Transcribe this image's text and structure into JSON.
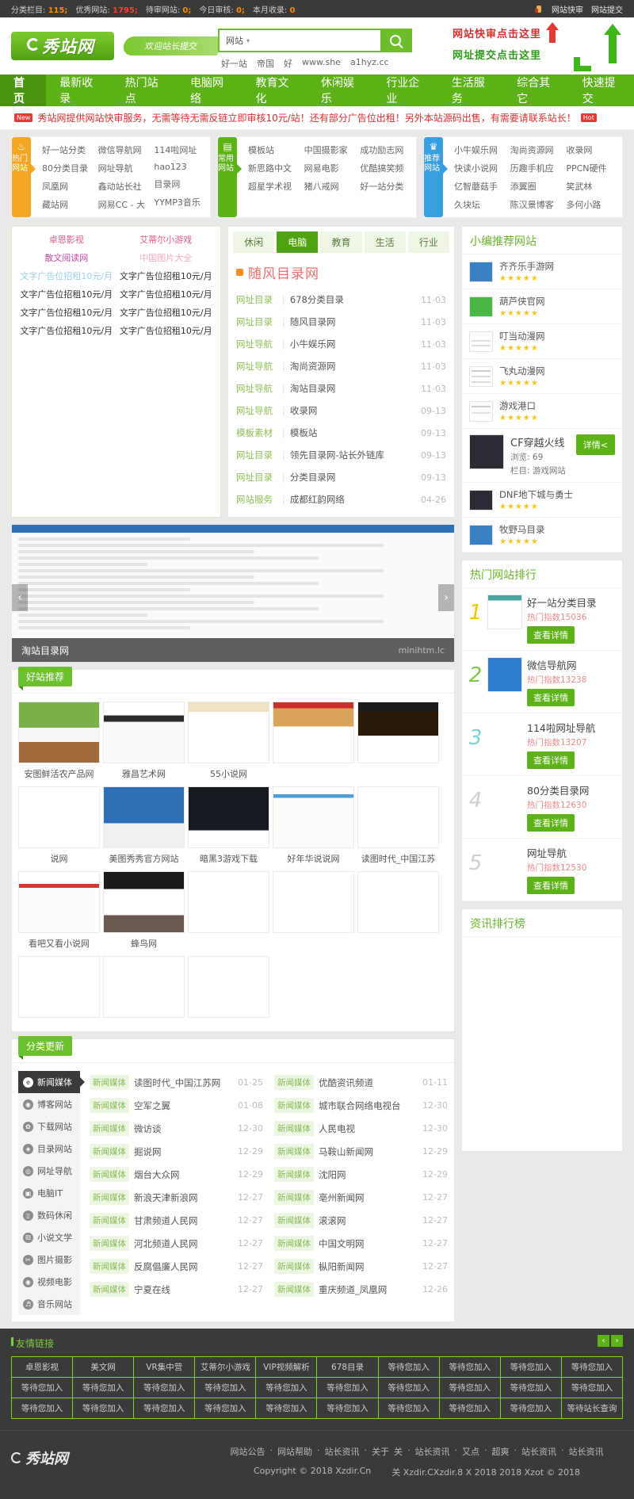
{
  "topbar": {
    "stats": [
      {
        "label": "分类栏目:",
        "value": "115;"
      },
      {
        "label": "优秀网站:",
        "value": "1795;"
      },
      {
        "label": "待审网站:",
        "value": "0;"
      },
      {
        "label": "今日审核:",
        "value": "0;"
      },
      {
        "label": "本月收录:",
        "value": "0"
      }
    ],
    "links": [
      "网站快审",
      "网站提交"
    ]
  },
  "header": {
    "logo_text": "秀站网",
    "slogan": "欢迎站长提交",
    "search": {
      "category": "网站",
      "placeholder": ""
    },
    "hotwords": [
      "好一站",
      "帝国",
      "好",
      "www.she",
      "a1hyz.cc"
    ],
    "promo_line1": "网站快审点击这里",
    "promo_line2": "网址提交点击这里"
  },
  "nav": {
    "items": [
      "首页",
      "最新收录",
      "热门站点",
      "电脑网络",
      "教育文化",
      "休闲娱乐",
      "行业企业",
      "生活服务",
      "综合其它",
      "快速提交"
    ],
    "active": "首页"
  },
  "notice": {
    "new": "New",
    "hot": "Hot",
    "text": "秀站网提供网站快审服务，无需等待无需反链立即审核10元/站！还有部分广告位出租！另外本站源码出售，有需要请联系站长！"
  },
  "quicklinks": [
    {
      "tab": "热门网站",
      "icon": "fire-icon",
      "color": "orange",
      "cols": [
        [
          "好一站分类",
          "80分类目录",
          "凤凰网",
          "藏站网"
        ],
        [
          "微信导航网",
          "网址导航",
          "鑫动站长社",
          "网易CC - 大"
        ],
        [
          "114啦网址",
          "hao123",
          "目录网",
          "YYMP3音乐"
        ]
      ]
    },
    {
      "tab": "常用网站",
      "icon": "grid-icon",
      "color": "green",
      "cols": [
        [
          "模板站",
          "新思路中文",
          "超星学术视"
        ],
        [
          "中国摄影家",
          "网易电影",
          "猪八戒网"
        ],
        [
          "成功励志网",
          "优酷搞笑频",
          "好一站分类"
        ]
      ]
    },
    {
      "tab": "推荐网站",
      "icon": "crown-icon",
      "color": "blue",
      "cols": [
        [
          "小牛娱乐网",
          "快读小说网",
          "亿智蘑菇手",
          "久块坛"
        ],
        [
          "淘尚资源网",
          "历趣手机应",
          "添翼圈",
          "陈汉景博客"
        ],
        [
          "收录网",
          "PPCN硬件",
          "笑武林",
          "多何小路"
        ]
      ]
    }
  ],
  "adbox": {
    "left": [
      "卓恩影视",
      "散文阅读网",
      "文字广告位招租10元/月",
      "文字广告位招租10元/月",
      "文字广告位招租10元/月",
      "文字广告位招租10元/月"
    ],
    "right": [
      "艾蒂尔小游戏",
      "中国图片大全",
      "文字广告位招租10元/月",
      "文字广告位招租10元/月",
      "文字广告位招租10元/月",
      "文字广告位招租10元/月"
    ]
  },
  "listbox": {
    "tabs": [
      "休闲",
      "电脑",
      "教育",
      "生活",
      "行业"
    ],
    "active_tab": "电脑",
    "brand": "随风目录网",
    "items": [
      {
        "cat": "网址目录",
        "name": "678分类目录",
        "date": "11-03"
      },
      {
        "cat": "网址目录",
        "name": "随风目录网",
        "date": "11-03"
      },
      {
        "cat": "网址导航",
        "name": "小牛娱乐网",
        "date": "11-03"
      },
      {
        "cat": "网址导航",
        "name": "淘尚资源网",
        "date": "11-03"
      },
      {
        "cat": "网址导航",
        "name": "淘站目录网",
        "date": "11-03"
      },
      {
        "cat": "网址导航",
        "name": "收录网",
        "date": "09-13"
      },
      {
        "cat": "模板素材",
        "name": "模板站",
        "date": "09-13"
      },
      {
        "cat": "网址目录",
        "name": "领先目录网-站长外链库",
        "date": "09-13"
      },
      {
        "cat": "网址目录",
        "name": "分类目录网",
        "date": "09-13"
      },
      {
        "cat": "网站服务",
        "name": "成都红韵网络",
        "date": "04-26"
      }
    ]
  },
  "slider": {
    "caption": "淘站目录网",
    "watermark": "minihtm.lc"
  },
  "recommend": {
    "title": "小编推荐网站",
    "items": [
      {
        "name": "齐齐乐手游网",
        "stars": 5,
        "thumb": "blue"
      },
      {
        "name": "葫芦侠官网",
        "stars": 5,
        "thumb": "green"
      },
      {
        "name": "叮当动漫网",
        "stars": 5,
        "thumb": "grey"
      },
      {
        "name": "飞丸动漫网",
        "stars": 5,
        "thumb": "grey"
      },
      {
        "name": "游戏港口",
        "stars": 5,
        "thumb": "grey"
      }
    ],
    "featured": {
      "name": "CF穿越火线",
      "views_label": "浏览:",
      "views": "69",
      "cat_label": "栏目:",
      "cat": "游戏网站",
      "button": "详情<"
    },
    "after": [
      {
        "name": "DNF地下城与勇士",
        "stars": 5,
        "thumb": "dark"
      },
      {
        "name": "牧野马目录",
        "stars": 5,
        "thumb": "blue"
      }
    ]
  },
  "goodsites": {
    "title": "好站推荐",
    "row1": [
      "安图鲜活农产品网",
      "雅昌艺术网",
      "55小说网",
      "",
      "",
      "说网"
    ],
    "row2": [
      "美图秀秀官方网站",
      "暗黑3游戏下载",
      "好年华说说网",
      "读图时代_中国江苏",
      "看吧又看小说网",
      "蜂鸟网"
    ],
    "row3": [
      "",
      "",
      "",
      "",
      "",
      ""
    ]
  },
  "hotrank": {
    "title": "热门网站排行",
    "items": [
      {
        "rank": "1",
        "name": "好一站分类目录",
        "index_label": "热门指数",
        "index": "15036",
        "button": "查看详情"
      },
      {
        "rank": "2",
        "name": "微信导航网",
        "index_label": "热门指数",
        "index": "13238",
        "button": "查看详情"
      },
      {
        "rank": "3",
        "name": "114啦网址导航",
        "index_label": "热门指数",
        "index": "13207",
        "button": "查看详情"
      },
      {
        "rank": "4",
        "name": "80分类目录网",
        "index_label": "热门指数",
        "index": "12630",
        "button": "查看详情"
      },
      {
        "rank": "5",
        "name": "网址导航",
        "index_label": "热门指数",
        "index": "12530",
        "button": "查看详情"
      }
    ]
  },
  "catupdate": {
    "title": "分类更新",
    "side": [
      {
        "label": "新闻媒体",
        "icon": "compass-icon",
        "active": true
      },
      {
        "label": "博客网站",
        "icon": "globe-icon",
        "active": false
      },
      {
        "label": "下载网站",
        "icon": "gear-icon",
        "active": false
      },
      {
        "label": "目录网站",
        "icon": "shield-icon",
        "active": false
      },
      {
        "label": "网址导航",
        "icon": "target-icon",
        "active": false
      },
      {
        "label": "电脑IT",
        "icon": "monitor-icon",
        "active": false
      },
      {
        "label": "数码休闲",
        "icon": "phone-icon",
        "active": false
      },
      {
        "label": "小说文学",
        "icon": "book-icon",
        "active": false
      },
      {
        "label": "图片摄影",
        "icon": "image-icon",
        "active": false
      },
      {
        "label": "视频电影",
        "icon": "video-icon",
        "active": false
      },
      {
        "label": "音乐网站",
        "icon": "music-icon",
        "active": false
      }
    ],
    "col1": [
      {
        "lbl": "新闻媒体",
        "name": "读图时代_中国江苏网",
        "date": "01-25"
      },
      {
        "lbl": "新闻媒体",
        "name": "空军之翼",
        "date": "01-08"
      },
      {
        "lbl": "新闻媒体",
        "name": "微访谈",
        "date": "12-30"
      },
      {
        "lbl": "新闻媒体",
        "name": "掘说网",
        "date": "12-29"
      },
      {
        "lbl": "新闻媒体",
        "name": "烟台大众网",
        "date": "12-29"
      },
      {
        "lbl": "新闻媒体",
        "name": "新浪天津新浪网",
        "date": "12-27"
      },
      {
        "lbl": "新闻媒体",
        "name": "甘肃频道人民网",
        "date": "12-27"
      },
      {
        "lbl": "新闻媒体",
        "name": "河北频道人民网",
        "date": "12-27"
      },
      {
        "lbl": "新闻媒体",
        "name": "反腐倡廉人民网",
        "date": "12-27"
      },
      {
        "lbl": "新闻媒体",
        "name": "宁夏在线",
        "date": "12-27"
      }
    ],
    "col2": [
      {
        "lbl": "新闻媒体",
        "name": "优酷资讯频道",
        "date": "01-11"
      },
      {
        "lbl": "新闻媒体",
        "name": "城市联合网络电视台",
        "date": "12-30"
      },
      {
        "lbl": "新闻媒体",
        "name": "人民电视",
        "date": "12-30"
      },
      {
        "lbl": "新闻媒体",
        "name": "马鞍山新闻网",
        "date": "12-29"
      },
      {
        "lbl": "新闻媒体",
        "name": "沈阳网",
        "date": "12-29"
      },
      {
        "lbl": "新闻媒体",
        "name": "亳州新闻网",
        "date": "12-27"
      },
      {
        "lbl": "新闻媒体",
        "name": "滚滚网",
        "date": "12-27"
      },
      {
        "lbl": "新闻媒体",
        "name": "中国文明网",
        "date": "12-27"
      },
      {
        "lbl": "新闻媒体",
        "name": "枞阳新闻网",
        "date": "12-27"
      },
      {
        "lbl": "新闻媒体",
        "name": "重庆频道_凤凰网",
        "date": "12-26"
      }
    ]
  },
  "newsrank": {
    "title": "资讯排行榜"
  },
  "friendlinks": {
    "title": "友情链接",
    "prev": "‹",
    "next": "›",
    "cells": [
      "卓恩影视",
      "美文网",
      "VR集中营",
      "艾蒂尔小游戏",
      "VIP视频解析",
      "678目录",
      "等待您加入",
      "等待您加入",
      "等待您加入",
      "等待您加入",
      "等待您加入",
      "等待您加入",
      "等待您加入",
      "等待您加入",
      "等待您加入",
      "等待您加入",
      "等待您加入",
      "等待您加入",
      "等待您加入",
      "等待您加入",
      "等待您加入",
      "等待您加入",
      "等待您加入",
      "等待您加入",
      "等待您加入",
      "等待您加入",
      "等待您加入",
      "等待您加入",
      "等待您加入",
      "等待站长查询"
    ]
  },
  "footer": {
    "logo_text": "秀站网",
    "links": [
      "网站公告",
      "网站帮助",
      "站长资讯",
      "关于",
      "关",
      "站长资讯",
      "又点",
      "超爽",
      "站长资讯",
      "站长资讯"
    ],
    "copyright": "Copyright © 2018 Xzdir.Cn",
    "copyright2": "关    Xzdir.CXzdir.8 X 2018 2018 Xzot © 2018"
  }
}
